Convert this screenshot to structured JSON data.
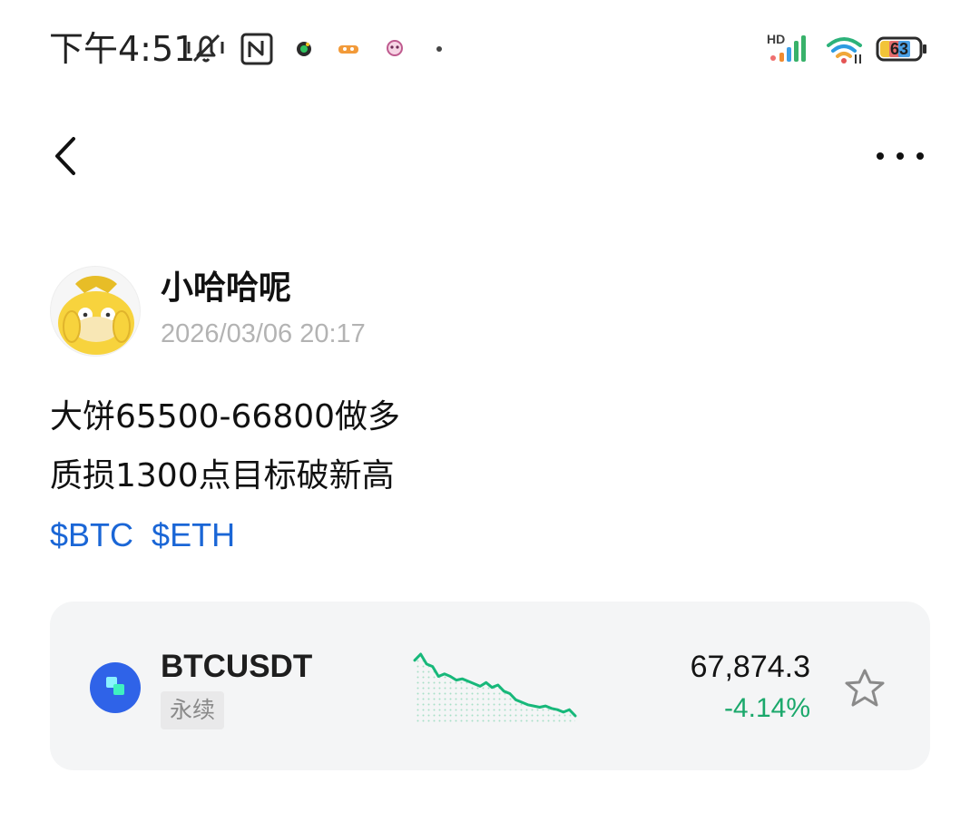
{
  "status_bar": {
    "time": "下午4:51",
    "network_label": "HD",
    "battery": "63"
  },
  "header": {
    "back_icon": "chevron-left-icon",
    "more_icon": "more-horizontal-icon"
  },
  "post": {
    "author": "小哈哈呢",
    "timestamp": "2026/03/06 20:17",
    "lines": [
      "大饼65500-66800做多",
      "质损1300点目标破新高"
    ],
    "tags": [
      "$BTC",
      "$ETH"
    ]
  },
  "ticker": {
    "symbol": "BTCUSDT",
    "contract_type": "永续",
    "price": "67,874.3",
    "change": "-4.14%",
    "trend": "down",
    "colors": {
      "positive_text": "#1aa86b",
      "sparkline": "#17b87a",
      "logo": "#2f63e8"
    },
    "sparkline": [
      65,
      70,
      62,
      60,
      52,
      54,
      52,
      49,
      50,
      48,
      46,
      44,
      47,
      43,
      45,
      40,
      38,
      33,
      31,
      29,
      28,
      27,
      28,
      26,
      25,
      23,
      25,
      20
    ]
  }
}
